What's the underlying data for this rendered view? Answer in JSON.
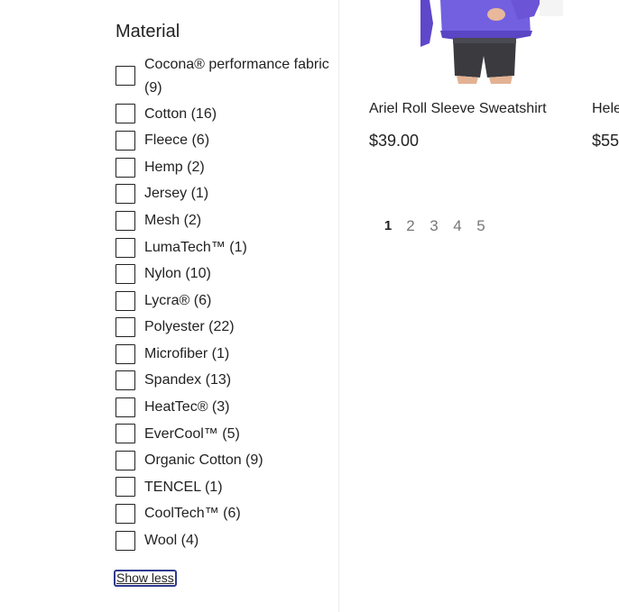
{
  "filter": {
    "title": "Material",
    "options": [
      {
        "label": "Cocona® performance fabric (9)",
        "checked": false
      },
      {
        "label": "Cotton (16)",
        "checked": false
      },
      {
        "label": "Fleece (6)",
        "checked": false
      },
      {
        "label": "Hemp (2)",
        "checked": false
      },
      {
        "label": "Jersey (1)",
        "checked": false
      },
      {
        "label": "Mesh (2)",
        "checked": false
      },
      {
        "label": "LumaTech™ (1)",
        "checked": false
      },
      {
        "label": "Nylon (10)",
        "checked": false
      },
      {
        "label": "Lycra® (6)",
        "checked": false
      },
      {
        "label": "Polyester (22)",
        "checked": false
      },
      {
        "label": "Microfiber (1)",
        "checked": false
      },
      {
        "label": "Spandex (13)",
        "checked": false
      },
      {
        "label": "HeatTec® (3)",
        "checked": false
      },
      {
        "label": "EverCool™ (5)",
        "checked": false
      },
      {
        "label": "Organic Cotton (9)",
        "checked": false
      },
      {
        "label": "TENCEL (1)",
        "checked": false
      },
      {
        "label": "CoolTech™ (6)",
        "checked": false
      },
      {
        "label": "Wool (4)",
        "checked": false
      }
    ],
    "show_less_label": "Show less"
  },
  "products": [
    {
      "name": "Ariel Roll Sleeve Sweatshirt",
      "price": "$39.00"
    },
    {
      "name": "Hele",
      "price": "$55"
    }
  ],
  "pagination": {
    "pages": [
      "1",
      "2",
      "3",
      "4",
      "5"
    ],
    "current": "1"
  },
  "colors": {
    "text": "#222222",
    "muted": "#777777",
    "focus_outline": "#2f3a8f",
    "shirt_purple": "#6b55d6",
    "shorts_gray": "#3a3a3f"
  }
}
